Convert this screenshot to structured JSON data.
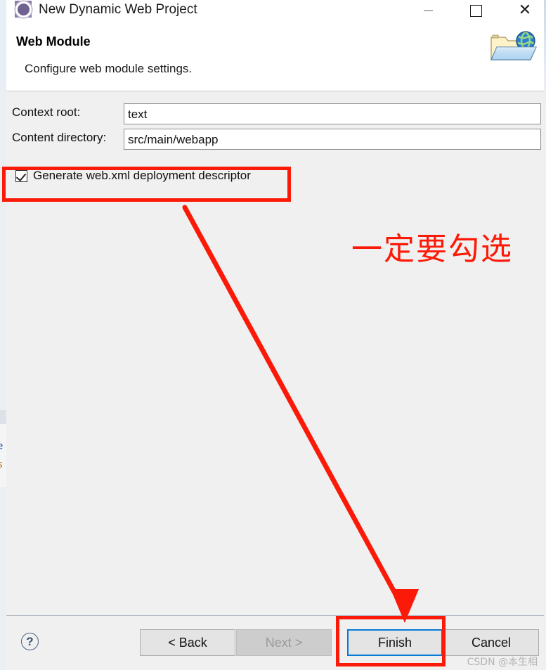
{
  "window": {
    "title": "New Dynamic Web Project",
    "icon": "eclipse-wizard-icon",
    "controls": {
      "minimize": "—",
      "maximize": "□",
      "close": "✕"
    }
  },
  "header": {
    "title": "Web Module",
    "subtitle": "Configure web module settings.",
    "icon": "web-folder-globe-icon"
  },
  "form": {
    "context_root": {
      "label": "Context root:",
      "value": "text",
      "placeholder": ""
    },
    "content_directory": {
      "label": "Content directory:",
      "value": "src/main/webapp",
      "placeholder": ""
    },
    "generate_web_xml": {
      "label": "Generate web.xml deployment descriptor",
      "checked": true
    }
  },
  "annotations": {
    "callout_text": "一定要勾选",
    "highlight_color": "#fb1a08",
    "arrow_from": "generate-web-xml-checkbox",
    "arrow_to": "finish-button"
  },
  "footer": {
    "help": "?",
    "back": "< Back",
    "next": "Next >",
    "finish": "Finish",
    "cancel": "Cancel",
    "next_disabled": true,
    "finish_focused": true,
    "focus_color": "#0a7bd4"
  },
  "watermark": "CSDN @本生相",
  "background_window": {
    "fragment_1": "e",
    "fragment_2": "s"
  }
}
